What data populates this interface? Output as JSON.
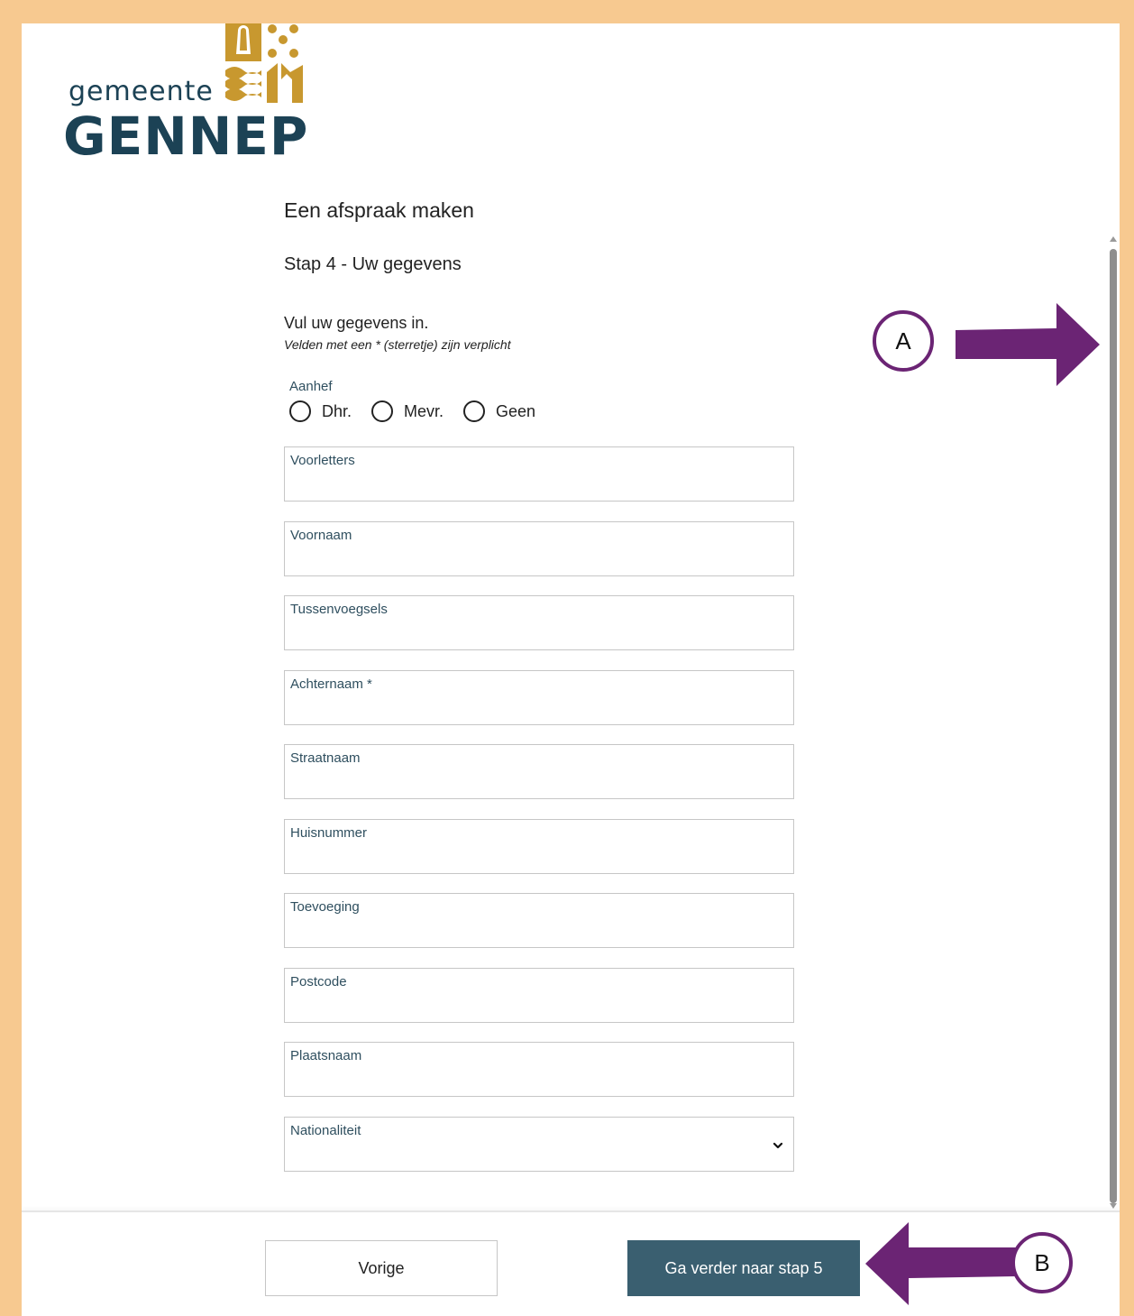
{
  "logo": {
    "word_small": "gemeente",
    "word_big": "GENNEP",
    "emblem_color": "#c8982f",
    "text_color": "#1c4255"
  },
  "page": {
    "title": "Een afspraak maken",
    "step_title": "Stap 4 - Uw gegevens",
    "intro": "Vul uw gegevens in.",
    "required_note": "Velden met een * (sterretje) zijn verplicht"
  },
  "aanhef": {
    "label": "Aanhef",
    "options": [
      "Dhr.",
      "Mevr.",
      "Geen"
    ]
  },
  "fields": [
    {
      "label": "Voorletters"
    },
    {
      "label": "Voornaam"
    },
    {
      "label": "Tussenvoegsels"
    },
    {
      "label": "Achternaam *"
    },
    {
      "label": "Straatnaam"
    },
    {
      "label": "Huisnummer"
    },
    {
      "label": "Toevoeging"
    },
    {
      "label": "Postcode"
    },
    {
      "label": "Plaatsnaam"
    },
    {
      "label": "Nationaliteit",
      "type": "select"
    }
  ],
  "buttons": {
    "prev": "Vorige",
    "next": "Ga verder naar stap 5"
  },
  "annotations": {
    "a": "A",
    "b": "B",
    "color": "#6b2474"
  },
  "colors": {
    "frame": "#f7c990",
    "button_primary": "#3a5f70",
    "label": "#2f4f5f"
  }
}
